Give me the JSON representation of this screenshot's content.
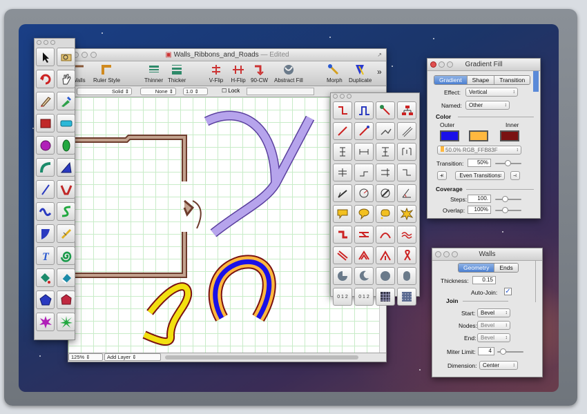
{
  "document_window": {
    "title": "Walls_Ribbons_and_Roads",
    "status": "— Edited",
    "toolbar": [
      {
        "label": "Walls",
        "icon": "walls-icon"
      },
      {
        "label": "Ruler Style",
        "icon": "ruler-style-icon"
      },
      {
        "label": "Thinner",
        "icon": "thinner-icon"
      },
      {
        "label": "Thicker",
        "icon": "thicker-icon"
      },
      {
        "label": "V-Flip",
        "icon": "v-flip-icon"
      },
      {
        "label": "H-Flip",
        "icon": "h-flip-icon"
      },
      {
        "label": "90-CW",
        "icon": "rotate-cw-icon"
      },
      {
        "label": "Abstract Fill",
        "icon": "abstract-fill-icon"
      },
      {
        "label": "Morph",
        "icon": "morph-icon"
      },
      {
        "label": "Duplicate",
        "icon": "duplicate-icon"
      }
    ],
    "overflow_label": "»",
    "style_bar": {
      "line_style": "Solid",
      "arrow_style": "None",
      "line_width": "1.0",
      "lock_label": "Lock"
    },
    "zoom": "125%",
    "layer": "Add Layer"
  },
  "gradient_panel": {
    "title": "Gradient Fill",
    "tabs": [
      "Gradient",
      "Shape",
      "Transition"
    ],
    "effect_label": "Effect:",
    "effect_value": "Vertical",
    "named_label": "Named:",
    "named_value": "Other",
    "color_heading": "Color",
    "outer_label": "Outer",
    "inner_label": "Inner",
    "colors": {
      "outer": "#1a10e8",
      "middle": "#ffb83f",
      "inner": "#7a1212"
    },
    "color_readout": "50.0% RGB_FFB83F",
    "transition_label": "Transition:",
    "transition_value": "50%",
    "add_label": "+",
    "even_label": "Even Transitions",
    "remove_label": "−",
    "coverage_heading": "Coverage",
    "steps_label": "Steps:",
    "steps_value": "100.",
    "overlap_label": "Overlap:",
    "overlap_value": "100%"
  },
  "walls_panel": {
    "title": "Walls",
    "tabs": [
      "Geometry",
      "Ends"
    ],
    "thickness_label": "Thickness:",
    "thickness_value": "0.15",
    "autojoin_label": "Auto-Join:",
    "join_heading": "Join",
    "start_label": "Start:",
    "start_value": "Bevel",
    "nodes_label": "Nodes:",
    "nodes_value": "Bevel",
    "end_label": "End:",
    "end_value": "Bevel",
    "miter_label": "Miter Limit:",
    "miter_value": "4",
    "dimension_label": "Dimension:",
    "dimension_value": "Center"
  },
  "palette": {
    "ruler_label_1": "0 1 2",
    "ruler_label_2": "0 1 2"
  }
}
